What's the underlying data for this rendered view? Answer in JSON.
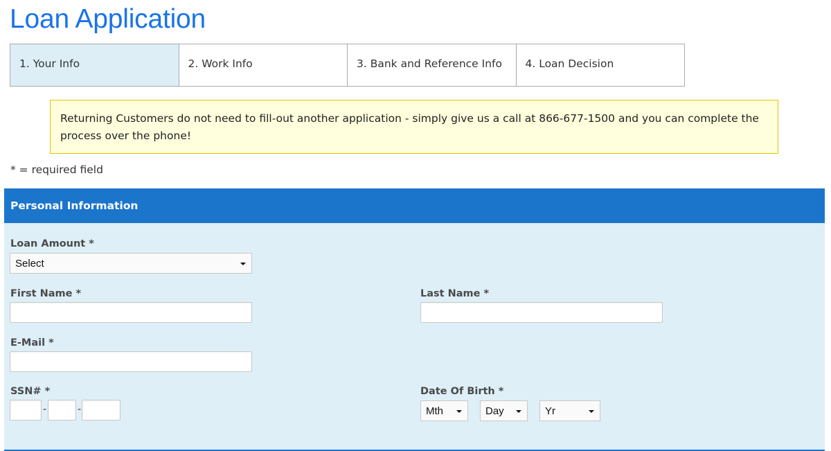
{
  "page": {
    "title": "Loan Application"
  },
  "steps": [
    {
      "label": "1. Your Info",
      "active": true
    },
    {
      "label": "2. Work Info",
      "active": false
    },
    {
      "label": "3. Bank and Reference Info",
      "active": false
    },
    {
      "label": "4. Loan Decision",
      "active": false
    }
  ],
  "notice": {
    "text": "Returning Customers do not need to fill-out another application - simply give us a call at 866-677-1500 and you can complete the process over the phone!"
  },
  "required_note": "* = required field",
  "section": {
    "title": "Personal Information",
    "fields": {
      "loan_amount": {
        "label": "Loan Amount *",
        "selected": "Select"
      },
      "first_name": {
        "label": "First Name *",
        "value": ""
      },
      "last_name": {
        "label": "Last Name *",
        "value": ""
      },
      "email": {
        "label": "E-Mail *",
        "value": ""
      },
      "ssn": {
        "label": "SSN# *",
        "part1": "",
        "part2": "",
        "part3": "",
        "separator": "-"
      },
      "dob": {
        "label": "Date Of Birth *",
        "month_selected": "Mth",
        "day_selected": "Day",
        "year_selected": "Yr"
      }
    }
  },
  "colors": {
    "title_blue": "#1a73e8",
    "header_blue": "#1b75cb",
    "section_bg": "#deeff7",
    "active_step_bg": "#ddeef7",
    "notice_bg": "#ffffdd",
    "notice_border": "#e8c300"
  }
}
